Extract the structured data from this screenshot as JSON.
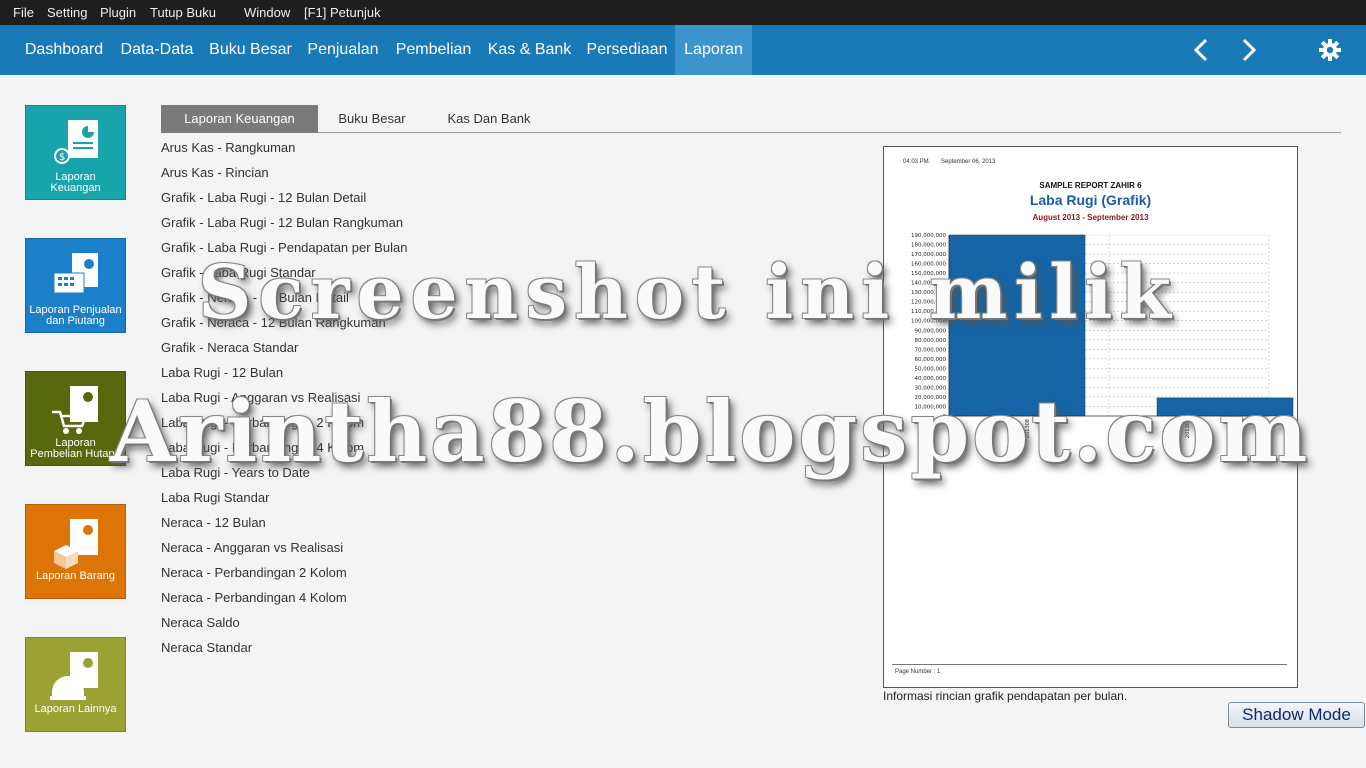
{
  "menubar": {
    "items": [
      "File",
      "Setting",
      "Plugin",
      "Tutup Buku",
      "Window",
      "[F1] Petunjuk"
    ]
  },
  "nav": {
    "items": [
      "Dashboard",
      "Data-Data",
      "Buku Besar",
      "Penjualan",
      "Pembelian",
      "Kas & Bank",
      "Persediaan",
      "Laporan"
    ],
    "active": "Laporan"
  },
  "tiles": [
    {
      "label": "Laporan\nKeuangan",
      "color": "#17a5ab"
    },
    {
      "label": "Laporan Penjualan\ndan Piutang",
      "color": "#1c7fc9"
    },
    {
      "label": "Laporan\nPembelian Hutang",
      "color": "#57680f"
    },
    {
      "label": "Laporan Barang",
      "color": "#dd7408"
    },
    {
      "label": "Laporan Lainnya",
      "color": "#9aa233"
    }
  ],
  "tabs": [
    "Laporan Keuangan",
    "Buku Besar",
    "Kas Dan Bank"
  ],
  "reports": [
    "Arus Kas - Rangkuman",
    "Arus Kas - Rincian",
    "Grafik - Laba Rugi - 12 Bulan Detail",
    "Grafik - Laba Rugi - 12 Bulan Rangkuman",
    "Grafik - Laba Rugi - Pendapatan per Bulan",
    "Grafik - Laba Rugi Standar",
    "Grafik - Neraca - 12 Bulan Detail",
    "Grafik - Neraca - 12 Bulan Rangkuman",
    "Grafik - Neraca Standar",
    "Laba Rugi - 12 Bulan",
    "Laba Rugi - Anggaran vs Realisasi",
    "Laba Rugi - Perbandingan 2 Kolom",
    "Laba Rugi - Perbandingan 4 Kolom",
    "Laba Rugi - Years to Date",
    "Laba Rugi Standar",
    "Neraca - 12 Bulan",
    "Neraca - Anggaran vs Realisasi",
    "Neraca - Perbandingan 2 Kolom",
    "Neraca - Perbandingan 4 Kolom",
    "Neraca Saldo",
    "Neraca Standar"
  ],
  "preview": {
    "time": "04:03 PM.",
    "date": "September 06, 2013",
    "company": "SAMPLE REPORT ZAHIR 6",
    "title": "Laba Rugi (Grafik)",
    "period": "August 2013 - September 2013",
    "page_number": "Page Number : 1"
  },
  "chart_data": {
    "type": "bar",
    "categories": [
      "201308",
      "201309"
    ],
    "values": [
      192000000,
      19000000
    ],
    "ylim": [
      0,
      190000000
    ],
    "yticks": [
      "190,000,000",
      "180,000,000",
      "170,000,000",
      "160,000,000",
      "150,000,000",
      "140,000,000",
      "130,000,000",
      "120,000,000",
      "110,000,000",
      "100,000,000",
      "90,000,000",
      "80,000,000",
      "70,000,000",
      "60,000,000",
      "50,000,000",
      "40,000,000",
      "30,000,000",
      "20,000,000",
      "10,000,000",
      "0"
    ],
    "bar_color": "#1565a6",
    "grid": true
  },
  "caption": "Informasi rincian grafik pendapatan per bulan.",
  "shadow_button": "Shadow Mode",
  "watermark": [
    "Screenshot ini milik",
    "Arintha88.blogspot.com"
  ],
  "colors": {
    "menubar": "#1e1e1e",
    "navbar": "#1a7ab8",
    "nav_active": "#3b94cc",
    "tab_active": "#7a7a7a",
    "title_blue": "#1a5fa3",
    "period_red": "#8b1a1a"
  }
}
